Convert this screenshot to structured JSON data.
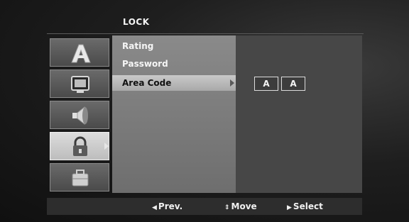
{
  "header": {
    "title": "LOCK"
  },
  "menu": {
    "items": [
      {
        "label": "Rating"
      },
      {
        "label": "Password"
      },
      {
        "label": "Area Code"
      }
    ],
    "selected_index": 2
  },
  "area_code": {
    "values": [
      "A",
      "A"
    ]
  },
  "icons": {
    "tabs": [
      "language-icon",
      "display-icon",
      "audio-icon",
      "lock-icon",
      "others-icon"
    ],
    "active_tab": "lock-icon"
  },
  "nav": {
    "prev": {
      "glyph": "◀",
      "label": "Prev."
    },
    "move": {
      "glyph": "⇕",
      "label": "Move"
    },
    "select": {
      "glyph": "▶",
      "label": "Select"
    }
  },
  "colors": {
    "background": "#151515",
    "menu_panel": "#7c7c7c",
    "value_panel": "#474747",
    "selected_row": "#b9b9b9",
    "nav_bar": "#2d2d2d"
  }
}
